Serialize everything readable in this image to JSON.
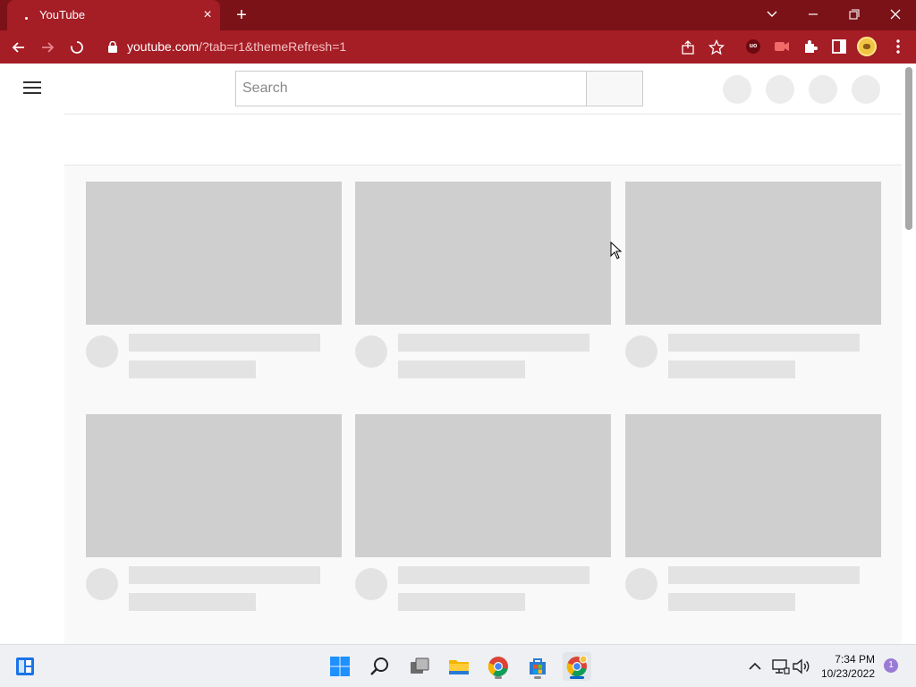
{
  "browser": {
    "tab": {
      "title": "YouTube",
      "close_glyph": "×"
    },
    "new_tab_glyph": "+",
    "url": {
      "host": "youtube.com",
      "path": "/?tab=r1&themeRefresh=1"
    },
    "colors": {
      "frame": "#7a1218",
      "toolbar": "#a51d25"
    }
  },
  "page": {
    "search": {
      "placeholder": "Search",
      "value": ""
    },
    "colors": {
      "skeleton_thumb": "#cfcfcf",
      "skeleton_text": "#e3e3e3",
      "content_bg": "#f9f9f9"
    }
  },
  "taskbar": {
    "time": "7:34 PM",
    "date": "10/23/2022",
    "notification_count": "1",
    "apps": [
      "windows-logo-icon",
      "search-icon",
      "task-view-icon",
      "file-explorer-icon",
      "chrome-icon",
      "microsoft-store-icon",
      "chrome-icon"
    ]
  }
}
